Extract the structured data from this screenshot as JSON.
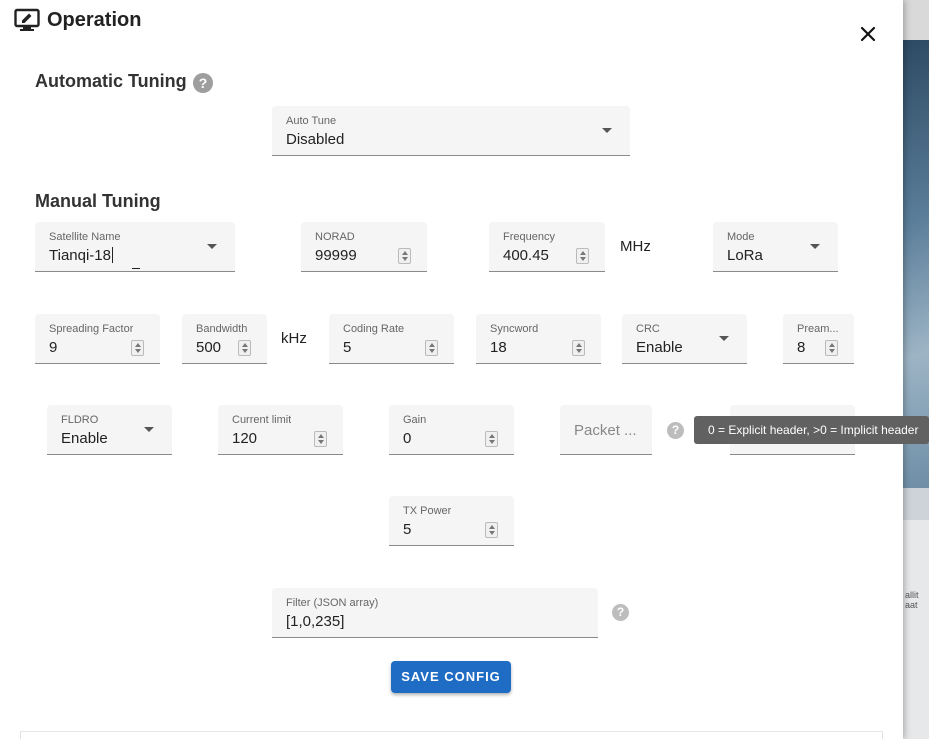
{
  "dialog": {
    "title": "Operation",
    "close_icon": "close-icon"
  },
  "automatic_tuning": {
    "heading": "Automatic Tuning",
    "help_icon": "help-icon",
    "auto_tune": {
      "label": "Auto Tune",
      "value": "Disabled"
    }
  },
  "manual_tuning": {
    "heading": "Manual Tuning",
    "satellite_name": {
      "label": "Satellite Name",
      "value": "Tianqi-18"
    },
    "norad": {
      "label": "NORAD",
      "value": "99999"
    },
    "frequency": {
      "label": "Frequency",
      "value": "400.45",
      "unit": "MHz"
    },
    "mode": {
      "label": "Mode",
      "value": "LoRa"
    },
    "spreading_factor": {
      "label": "Spreading Factor",
      "value": "9"
    },
    "bandwidth": {
      "label": "Bandwidth",
      "value": "500",
      "unit": "kHz"
    },
    "coding_rate": {
      "label": "Coding Rate",
      "value": "5"
    },
    "syncword": {
      "label": "Syncword",
      "value": "18"
    },
    "crc": {
      "label": "CRC",
      "value": "Enable"
    },
    "preamble": {
      "label": "Pream...",
      "value": "8"
    },
    "fldro": {
      "label": "FLDRO",
      "value": "Enable"
    },
    "current_limit": {
      "label": "Current limit",
      "value": "120"
    },
    "gain": {
      "label": "Gain",
      "value": "0"
    },
    "packet": {
      "placeholder": "Packet ..."
    },
    "tooltip": "0 = Explicit header, >0 = Implicit header",
    "tx_power": {
      "label": "TX Power",
      "value": "5"
    },
    "filter": {
      "label": "Filter (JSON array)",
      "value": "[1,0,235]"
    }
  },
  "actions": {
    "save_label": "SAVE CONFIG"
  },
  "background": {
    "text": "allit\naat"
  }
}
